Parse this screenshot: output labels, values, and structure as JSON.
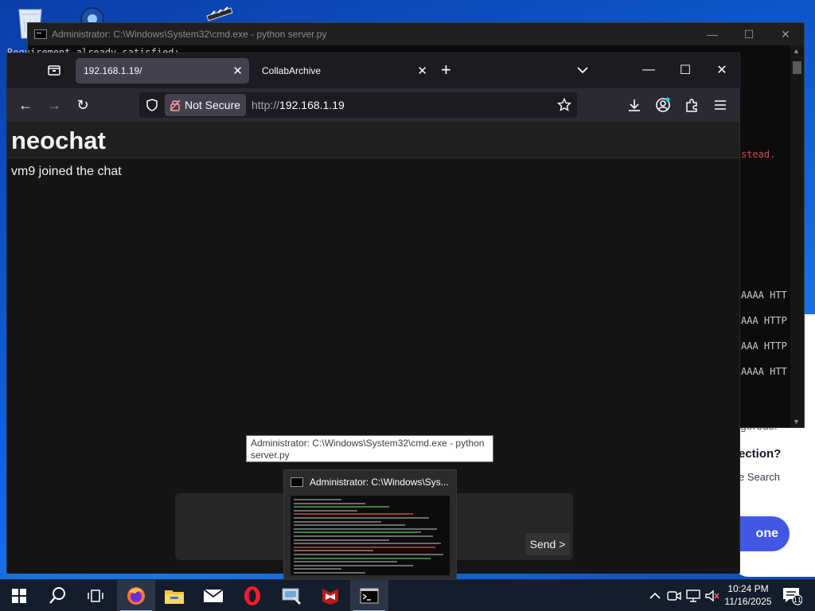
{
  "cmd": {
    "title": "Administrator: C:\\Windows\\System32\\cmd.exe - python  server.py",
    "top_text": "Requirement already satisfied: ...",
    "lines": [
      {
        "text": "stead.",
        "color": "#d74a4a"
      },
      {
        "text": "AAAA HTT"
      },
      {
        "text": "AAA HTTP"
      },
      {
        "text": "AAA HTTP"
      },
      {
        "text": "AAAA HTT"
      }
    ],
    "controls": {
      "minimize": "—",
      "maximize": "☐",
      "close": "✕"
    }
  },
  "bg_webpage": {
    "snippet1": "gerous.",
    "snippet2": "ection?",
    "snippet3": "e Search",
    "button": "one"
  },
  "browser": {
    "tabs": [
      {
        "label": "192.168.1.19/",
        "active": true,
        "close": "✕"
      },
      {
        "label": "CollabArchive",
        "active": false,
        "close": "✕"
      }
    ],
    "new_tab": "+",
    "nav": {
      "back": "←",
      "forward": "→",
      "reload": "↻"
    },
    "security_label": "Not Secure",
    "url_protocol": "http://",
    "url_host": "192.168.1.19",
    "window_controls": {
      "minimize": "—",
      "maximize": "☐",
      "close": "✕"
    }
  },
  "chat": {
    "title": "neochat",
    "messages": [
      "vm9 joined the chat"
    ],
    "send_label": "Send >"
  },
  "tooltip": {
    "text": "Administrator: C:\\Windows\\System32\\cmd.exe - python  server.py"
  },
  "preview": {
    "title": "Administrator: C:\\Windows\\Sys..."
  },
  "taskbar": {
    "apps": [
      "start-icon",
      "search-icon",
      "task-view-icon",
      "firefox-icon",
      "file-explorer-icon",
      "mail-icon",
      "opera-icon",
      "control-panel-icon",
      "mcafee-icon",
      "cmd-icon"
    ],
    "clock_time": "10:24 PM",
    "clock_date": "11/16/2025",
    "notification_count": "11",
    "colors": {
      "accent": "#76b9ed",
      "background": "#141d2b"
    }
  }
}
